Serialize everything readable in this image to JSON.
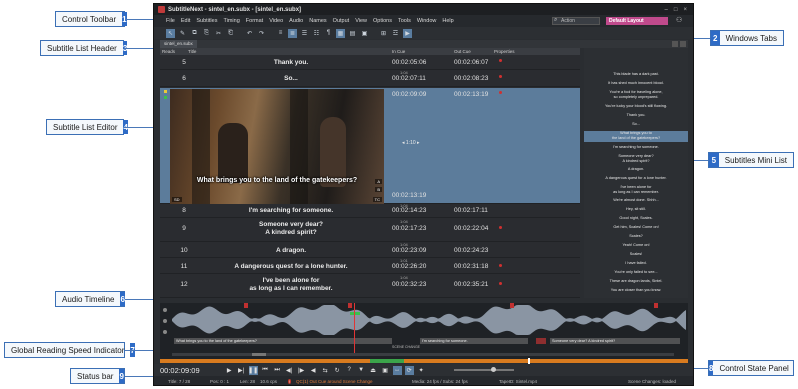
{
  "callouts": [
    {
      "label": "Control Toolbar",
      "num": "1"
    },
    {
      "label": "Windows Tabs",
      "num": "2"
    },
    {
      "label": "Subtitle List Header",
      "num": "3"
    },
    {
      "label": "Subtitle List Editor",
      "num": "4"
    },
    {
      "label": "Subtitles Mini List",
      "num": "5"
    },
    {
      "label": "Audio Timeline",
      "num": "6"
    },
    {
      "label": "Global Reading Speed Indicator",
      "num": "7"
    },
    {
      "label": "Control State Panel",
      "num": "8"
    },
    {
      "label": "Status bar",
      "num": "9"
    }
  ],
  "app": {
    "title": "SubtitleNext - sintel_en.subx - [sintel_en.subx]",
    "window_buttons": [
      "–",
      "□",
      "×"
    ],
    "menu": [
      "File",
      "Edit",
      "Subtitles",
      "Timing",
      "Format",
      "Video",
      "Audio",
      "Names",
      "Output",
      "View",
      "Options",
      "Tools",
      "Window",
      "Help"
    ],
    "search_placeholder": "Action",
    "layout_name": "Default Layout",
    "toolbar_icons": [
      "pointer-icon",
      "pen-icon",
      "copy-icon",
      "clip-icon",
      "cut-icon",
      "paste-icon",
      "undo-icon",
      "redo-icon",
      "align-left-icon",
      "align-center-icon",
      "align-right-icon",
      "align-justify-icon",
      "format-icon",
      "frame-icon",
      "grid-icon",
      "box-icon",
      "layout-icon",
      "list-icon",
      "video-icon"
    ],
    "toolbar_glyphs": [
      "↖",
      "✎",
      "⧉",
      "⎘",
      "✂",
      "⎗",
      "↶",
      "↷",
      "≡",
      "≣",
      "☰",
      "☷",
      "¶",
      "▦",
      "▤",
      "▣",
      "⊞",
      "☲",
      "▶"
    ],
    "tab_label": "sintel_en.subx"
  },
  "list": {
    "headers": {
      "nr": "Reads",
      "title": "Title",
      "in": "In Cue",
      "out": "Out Cue",
      "props": "Properties"
    },
    "rows": [
      {
        "num": "5",
        "text": "Thank you.",
        "dur": "",
        "in": "00:02:05:06",
        "out": "00:02:06:07"
      },
      {
        "num": "6",
        "text": "So...",
        "dur": "1:04",
        "in": "00:02:07:11",
        "out": "00:02:08:23"
      },
      {
        "num": "7",
        "text": "",
        "dur": "",
        "in": "00:02:09:09",
        "out": "00:02:13:19"
      },
      {
        "num": "8",
        "text": "I'm searching for someone.",
        "dur": "1:04",
        "in": "00:02:14:23",
        "out": "00:02:17:11"
      },
      {
        "num": "9",
        "text": "Someone very dear?\nA kindred spirit?",
        "dur": "1:04",
        "in": "00:02:17:23",
        "out": "00:02:22:04"
      },
      {
        "num": "10",
        "text": "A dragon.",
        "dur": "1:04",
        "in": "00:02:23:09",
        "out": "00:02:24:23"
      },
      {
        "num": "11",
        "text": "A dangerous quest for a lone hunter.",
        "dur": "1:01",
        "in": "00:02:26:20",
        "out": "00:02:31:18"
      },
      {
        "num": "12",
        "text": "I've been alone for\nas long as I can remember.",
        "dur": "1:04",
        "in": "00:02:32:23",
        "out": "00:02:35:21"
      }
    ],
    "selected_extra": {
      "in_label": "◂ 1:10 ▸",
      "out_time": "00:02:13:19"
    },
    "video_caption": "What brings you to\nthe land of the gatekeepers?"
  },
  "minilist": [
    "This blade has a dark past.",
    "It has shed much innocent blood.",
    "You're a fool for traveling alone,\nso completely unprepared.",
    "You're lucky your blood's still flowing.",
    "Thank you.",
    "So...",
    "What brings you to\nthe land of the gatekeepers?",
    "I'm searching for someone.",
    "Someone very dear?\nA kindred spirit?",
    "A dragon.",
    "A dangerous quest for a lone hunter.",
    "I've been alone for\nas long as I can remember.",
    "We're almost done. Shhh...",
    "Hey, sit still.",
    "Good night, Scales.",
    "Get him, Scales! Come on!",
    "Scales?",
    "Yeah! Come on!",
    "Scales!",
    "I have failed.",
    "You're only failed to see...",
    "These are dragon lands, Sintel.",
    "You are closer than you know."
  ],
  "audio": {
    "blocks": [
      {
        "label": "What brings you to the land of the gatekeepers?",
        "sel": false
      },
      {
        "label": "I'm searching for someone.",
        "sel": false
      },
      {
        "label": "Someone very dear? A kindred spirit?",
        "sel": false
      }
    ],
    "scene_label": "SCENE CHANGE"
  },
  "controls": {
    "timecode": "00:02:09:09",
    "buttons": [
      "▶",
      "▶|",
      "❚❚",
      "⏮",
      "⏭",
      "◀|",
      "|▶",
      "◀",
      "⇆",
      "↻",
      "?",
      "▼",
      "⏏",
      "▣",
      "↔",
      "⟳",
      "✦"
    ]
  },
  "status": {
    "title": "Title: 7 / 28",
    "pos": "Pos: 0 : 1",
    "len": "Len: 28",
    "sr": "10.6 cps",
    "warning": "QC(1) Out Cue around Scene Change",
    "media": "Media: 24 fps / Subs: 24 fps",
    "file": "TapeID: Sintel.mp4",
    "scene": "Scene Changes: loaded"
  }
}
